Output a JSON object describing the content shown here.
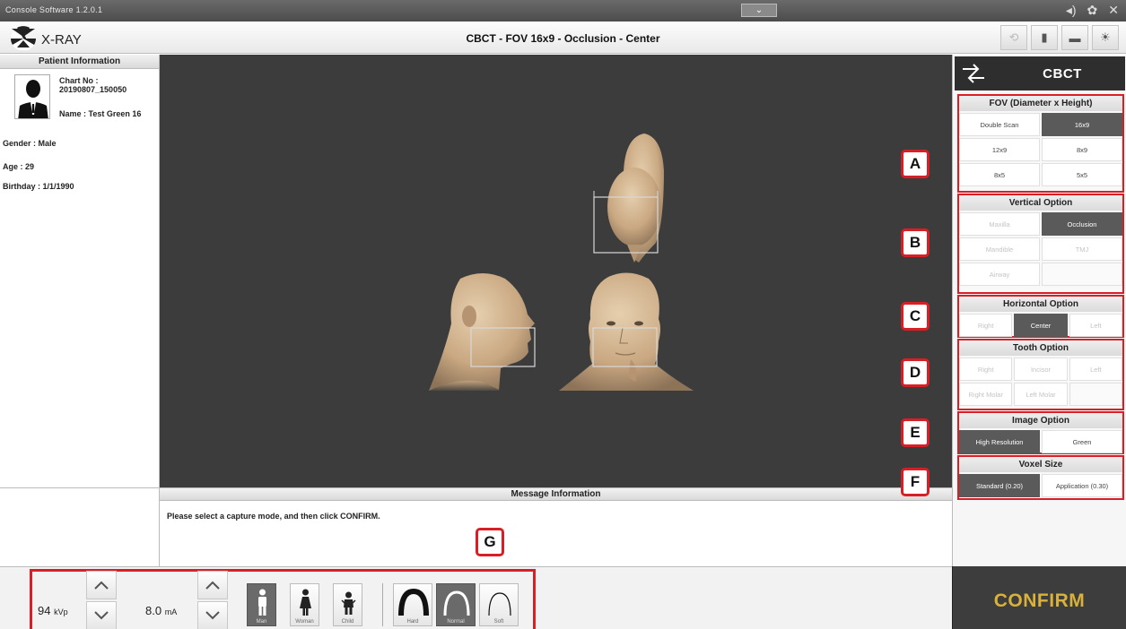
{
  "titlebar": {
    "app_version": "Console Software  1.2.0.1",
    "handle_icon": "chevron-down-icon"
  },
  "header": {
    "app_name": "X-RAY",
    "mode_title": "CBCT - FOV 16x9 - Occlusion - Center"
  },
  "patient": {
    "panel_title": "Patient Information",
    "chart_label": "Chart No :",
    "chart_no": "20190807_150050",
    "name": "Name : Test Green 16",
    "gender": "Gender : Male",
    "age": "Age : 29",
    "birthday": "Birthday : 1/1/1990"
  },
  "right_panel": {
    "mode": "CBCT",
    "fov": {
      "title": "FOV (Diameter x Height)",
      "options": [
        "Double Scan",
        "16x9",
        "12x9",
        "8x9",
        "8x5",
        "5x5"
      ],
      "selected": "16x9"
    },
    "vertical": {
      "title": "Vertical Option",
      "options": [
        "Maxilla",
        "Occlusion",
        "Mandible",
        "TMJ",
        "Airway"
      ],
      "selected": "Occlusion"
    },
    "horizontal": {
      "title": "Horizontal Option",
      "options": [
        "Right",
        "Center",
        "Left"
      ],
      "selected": "Center"
    },
    "tooth": {
      "title": "Tooth Option",
      "options": [
        "Right",
        "Incisor",
        "Left",
        "Right Molar",
        "Left Molar"
      ]
    },
    "image": {
      "title": "Image Option",
      "options": [
        "High Resolution",
        "Green"
      ],
      "selected": "High Resolution"
    },
    "voxel": {
      "title": "Voxel Size",
      "options": [
        "Standard  (0.20)",
        "Application (0.30)"
      ],
      "selected": "Standard  (0.20)"
    }
  },
  "callouts": [
    "A",
    "B",
    "C",
    "D",
    "E",
    "F",
    "G"
  ],
  "message": {
    "title": "Message Information",
    "text": "Please select a capture mode, and then click CONFIRM."
  },
  "bottom": {
    "kvp_value": "94",
    "kvp_unit": "kVp",
    "ma_value": "8.0",
    "ma_unit": "mA",
    "patient_types": [
      "Man",
      "Woman",
      "Child"
    ],
    "patient_selected": "Man",
    "arch_types": [
      "Hard",
      "Normal",
      "Soft"
    ],
    "arch_selected": "Normal"
  },
  "confirm_label": "CONFIRM",
  "colors": {
    "callout_red": "#d91f26",
    "confirm_gold": "#d8b23a",
    "viewer_bg": "#3c3c3c",
    "selected_gray": "#5a5a5a"
  }
}
